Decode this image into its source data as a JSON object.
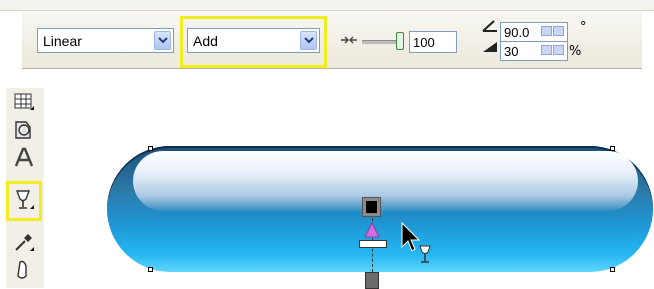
{
  "property_bar": {
    "gradient_type": "Linear",
    "merge_mode": "Add",
    "midpoint_value": "100",
    "angle_value": "90.0",
    "angle_unit": "°",
    "edge_pad_value": "30",
    "edge_pad_unit": "%"
  },
  "toolbox": {
    "tools": [
      "table-tool",
      "shape-tool",
      "text-tool",
      "interactive-transparency-tool",
      "eyedropper-tool",
      "fill-tool"
    ],
    "active_tool": "interactive-transparency-tool"
  },
  "colors": {
    "highlight": "#f1ee1f",
    "pill_top": "#1f4f79",
    "pill_bottom": "#5fd5ff"
  }
}
